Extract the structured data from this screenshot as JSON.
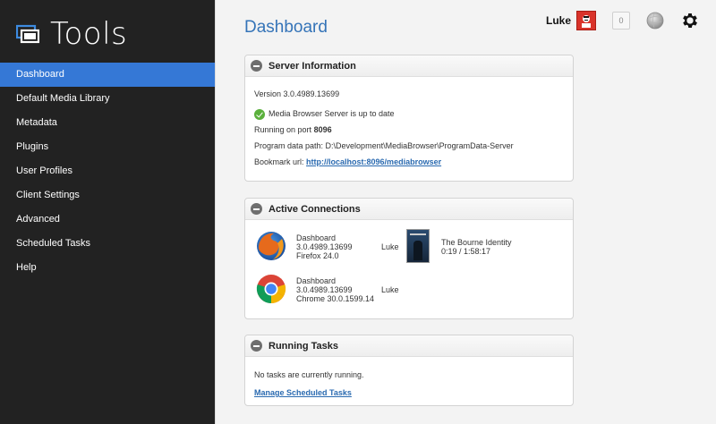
{
  "brand": {
    "title": "Tools"
  },
  "nav": {
    "items": [
      {
        "label": "Dashboard",
        "active": true
      },
      {
        "label": "Default Media Library"
      },
      {
        "label": "Metadata"
      },
      {
        "label": "Plugins"
      },
      {
        "label": "User Profiles"
      },
      {
        "label": "Client Settings"
      },
      {
        "label": "Advanced"
      },
      {
        "label": "Scheduled Tasks"
      },
      {
        "label": "Help"
      }
    ]
  },
  "header": {
    "page_title": "Dashboard",
    "user_name": "Luke",
    "notification_count": "0"
  },
  "server_info": {
    "title": "Server Information",
    "version": "Version 3.0.4989.13699",
    "status": "Media Browser Server is up to date",
    "port_label": "Running on port",
    "port": "8096",
    "data_path": "Program data path: D:\\Development\\MediaBrowser\\ProgramData-Server",
    "bookmark_label": "Bookmark url:",
    "bookmark_url": "http://localhost:8096/mediabrowser"
  },
  "connections": {
    "title": "Active Connections",
    "items": [
      {
        "app": "Dashboard",
        "version": "3.0.4989.13699",
        "client": "Firefox 24.0",
        "user": "Luke",
        "now_playing": "The Bourne Identity",
        "progress": "0:19 / 1:58:17"
      },
      {
        "app": "Dashboard",
        "version": "3.0.4989.13699",
        "client": "Chrome 30.0.1599.14",
        "user": "Luke"
      }
    ]
  },
  "running_tasks": {
    "title": "Running Tasks",
    "message": "No tasks are currently running.",
    "manage_link": "Manage Scheduled Tasks"
  },
  "colors": {
    "sidebar_bg": "#222222",
    "active_nav": "#3578d6",
    "title_blue": "#3574b8",
    "link_blue": "#2a6ab0",
    "ok_green": "#5ab03c"
  }
}
